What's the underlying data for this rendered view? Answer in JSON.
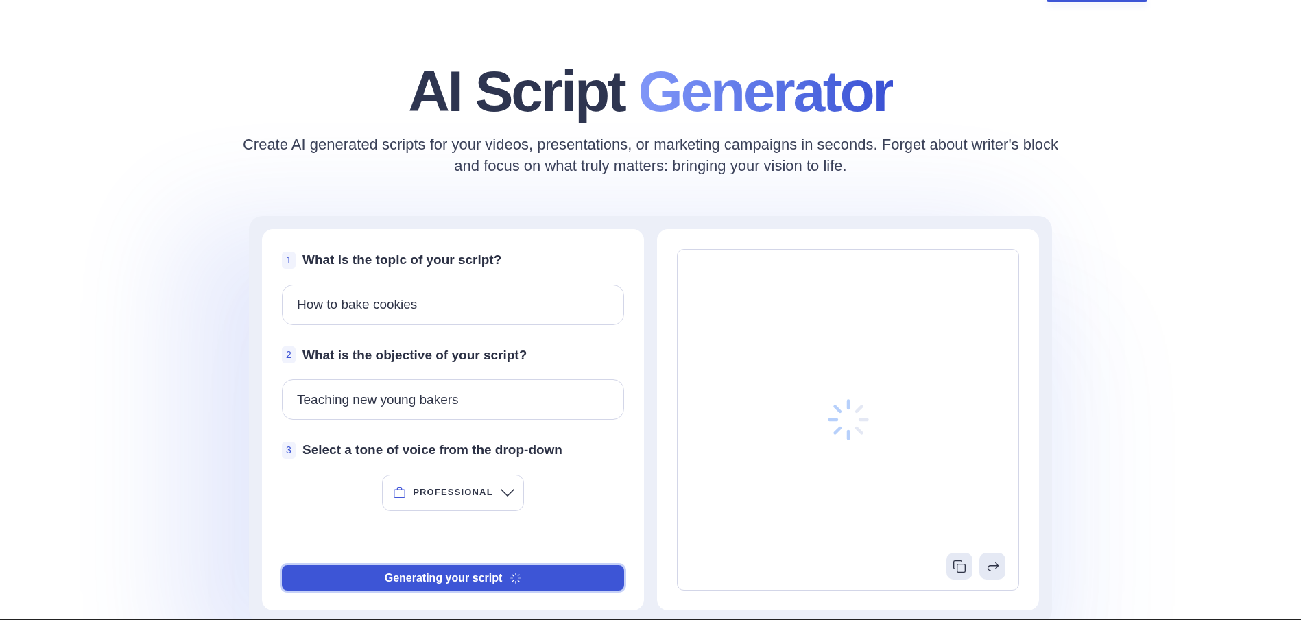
{
  "hero": {
    "title": [
      {
        "text": "AI Script",
        "highlight": false
      },
      {
        "text": "Generator",
        "highlight": true
      }
    ],
    "subtitle": "Create AI generated scripts for your videos, presentations, or marketing campaigns in seconds. Forget about writer's block and focus on what truly matters: bringing your vision to life."
  },
  "form": {
    "steps": [
      {
        "number": "1",
        "label": "What is the topic of your script?",
        "kind": "text",
        "value": "How to bake cookies"
      },
      {
        "number": "2",
        "label": "What is the objective of your script?",
        "kind": "text",
        "value": "Teaching new young bakers"
      },
      {
        "number": "3",
        "label": "Select a tone of voice from the drop-down",
        "kind": "dropdown",
        "value": "PROFESSIONAL"
      }
    ],
    "submit": {
      "label": "Generating your script",
      "loading": true
    }
  },
  "output": {
    "loading": true
  }
}
